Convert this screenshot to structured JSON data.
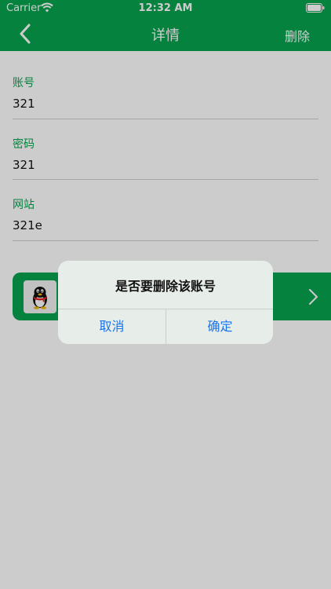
{
  "status_bar": {
    "carrier": "Carrier",
    "time": "12:32 AM"
  },
  "nav": {
    "title": "详情",
    "delete_label": "删除"
  },
  "fields": [
    {
      "label": "账号",
      "value": "321"
    },
    {
      "label": "密码",
      "value": "321"
    },
    {
      "label": "网站",
      "value": "321e"
    }
  ],
  "app_card": {
    "icon": "qq-penguin-icon"
  },
  "alert": {
    "title": "是否要删除该账号",
    "cancel_label": "取消",
    "confirm_label": "确定"
  },
  "colors": {
    "accent": "#08A34F",
    "link": "#1A73E8"
  }
}
